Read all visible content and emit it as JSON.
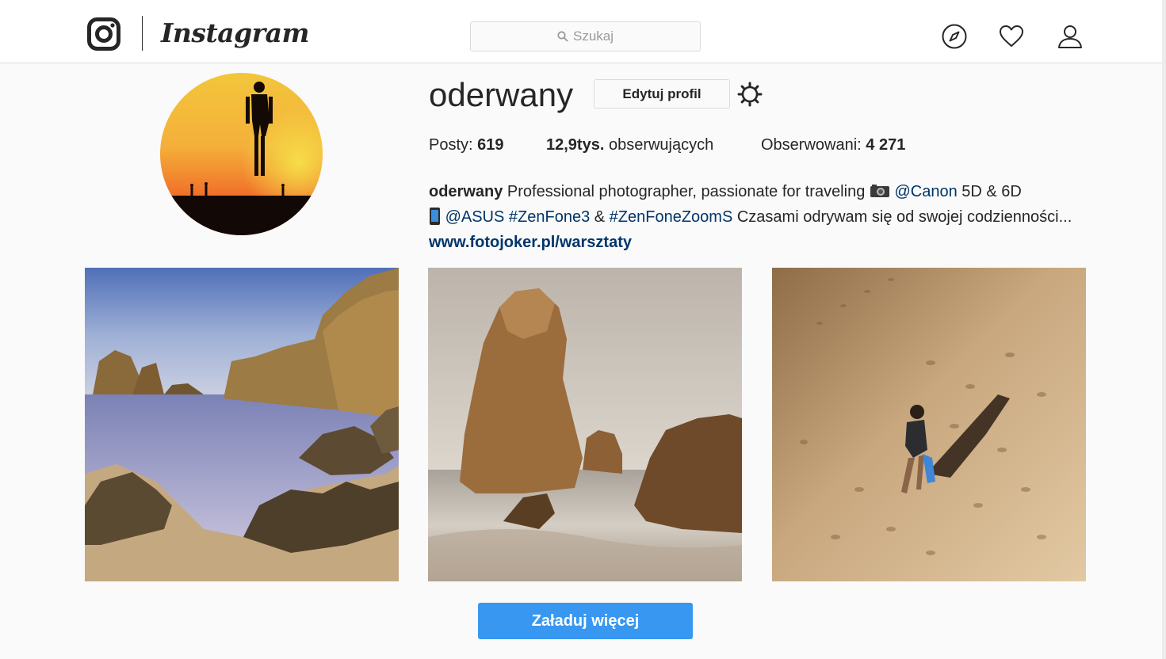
{
  "nav": {
    "wordmark": "Instagram",
    "search_placeholder": "Szukaj",
    "icons": [
      "instagram-logo-icon",
      "search-icon",
      "compass-icon",
      "heart-icon",
      "user-icon"
    ]
  },
  "profile": {
    "username": "oderwany",
    "edit_button": "Edytuj profil",
    "stats": {
      "posts_label": "Posty:",
      "posts_value": "619",
      "followers_value": "12,9tys.",
      "followers_label": "obserwujących",
      "following_label": "Obserwowani:",
      "following_value": "4 271"
    },
    "bio": {
      "name": "oderwany",
      "text1": "Professional photographer, passionate for traveling",
      "mention_canon": "@Canon",
      "text2": "5D & 6D",
      "mention_asus": "@ASUS",
      "tag_zenfone3": "#ZenFone3",
      "amp": "&",
      "tag_zoom": "#ZenFoneZoomS",
      "text3": "Czasami odrywam się od swojej codzienności...",
      "link": "www.fotojoker.pl/warsztaty"
    }
  },
  "load_more": "Załaduj więcej",
  "colors": {
    "accent": "#3897f0",
    "link": "#003569",
    "border": "#dbdbdb",
    "background": "#fafafa"
  }
}
